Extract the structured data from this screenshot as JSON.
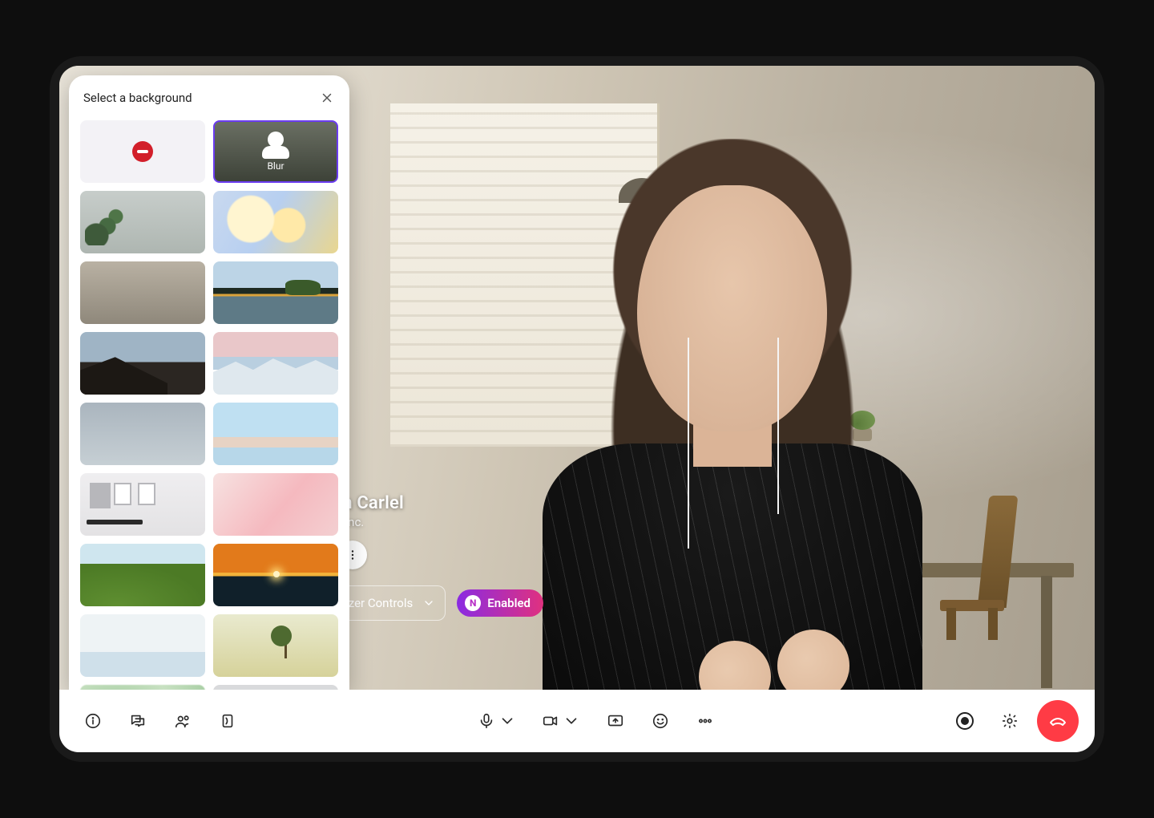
{
  "panel": {
    "title": "Select a background",
    "options": {
      "none_label": "None",
      "blur_label": "Blur"
    }
  },
  "participant": {
    "name": "Kristin Carlel",
    "company": "erolabs, Inc."
  },
  "controls": {
    "organizer_label": "Organizer Controls",
    "enabled_label": "Enabled",
    "badge_glyph": "N"
  },
  "toolbar": {
    "mic_on": true,
    "camera_on": true
  }
}
